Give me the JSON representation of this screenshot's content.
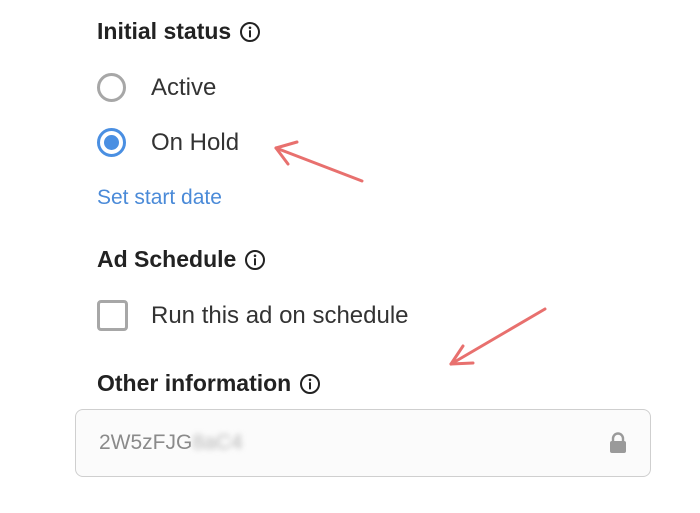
{
  "initial_status": {
    "title": "Initial status",
    "options": [
      {
        "label": "Active",
        "checked": false
      },
      {
        "label": "On Hold",
        "checked": true
      }
    ],
    "set_start_date_link": "Set start date"
  },
  "ad_schedule": {
    "title": "Ad Schedule",
    "checkbox_label": "Run this ad on schedule",
    "checked": false
  },
  "other_information": {
    "title": "Other information",
    "field_value_visible": "2W5zFJG",
    "field_value_obscured": "8aC4",
    "locked": true
  },
  "icons": {
    "info": "info-icon",
    "lock": "lock-icon"
  },
  "colors": {
    "accent": "#4a8fe2",
    "link": "#4a8ad8",
    "annotation_arrow": "#e8706e"
  }
}
